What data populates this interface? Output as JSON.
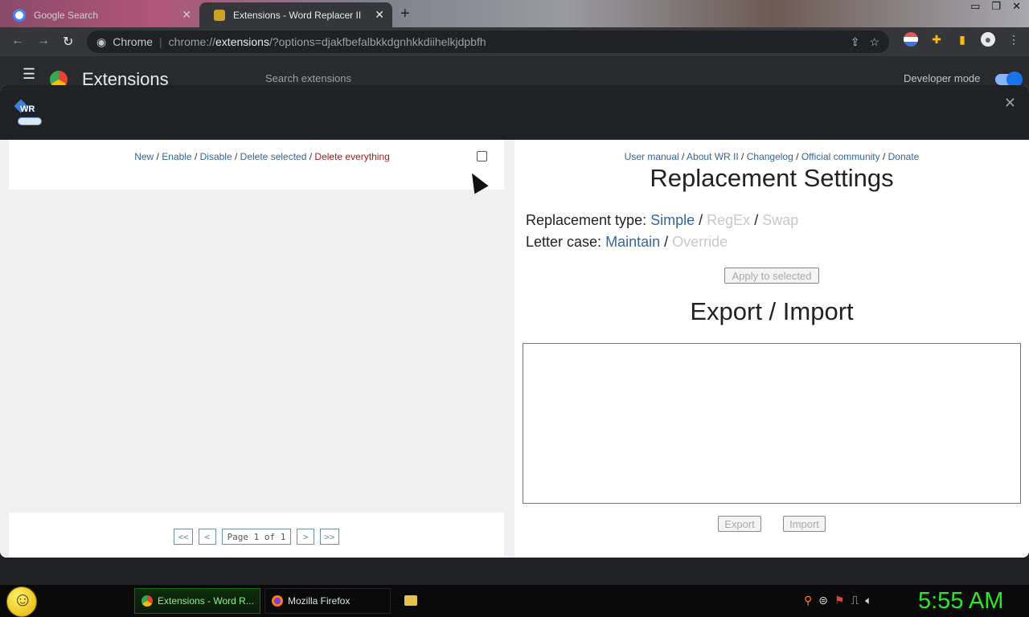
{
  "browser": {
    "tabs": [
      {
        "title": "Google Search"
      },
      {
        "title": "Extensions - Word Replacer II"
      }
    ],
    "url_prefix": "Chrome",
    "url_scheme": "chrome://",
    "url_host": "extensions",
    "url_rest": "/?options=djakfbefalbkkdgnhkkdiihelkjdpbfh"
  },
  "extensions_page": {
    "title": "Extensions",
    "search_placeholder": "Search extensions",
    "dev_mode_label": "Developer mode"
  },
  "dialog": {
    "logo_text": "WR",
    "left": {
      "links": {
        "new": "New",
        "enable": "Enable",
        "disable": "Disable",
        "delete_selected": "Delete selected",
        "delete_everything": "Delete everything"
      },
      "pager": {
        "first": "<<",
        "prev": "<",
        "page": "Page 1 of 1",
        "next": ">",
        "last": ">>"
      }
    },
    "right": {
      "links": {
        "manual": "User manual",
        "about": "About WR II",
        "changelog": "Changelog",
        "community": "Official community",
        "donate": "Donate"
      },
      "settings_title": "Replacement Settings",
      "type_label": "Replacement type:",
      "type_options": [
        "Simple",
        "RegEx",
        "Swap"
      ],
      "case_label": "Letter case:",
      "case_options": [
        "Maintain",
        "Override"
      ],
      "apply_button": "Apply to selected",
      "export_title": "Export / Import",
      "export_button": "Export",
      "import_button": "Import"
    }
  },
  "taskbar": {
    "tasks": [
      {
        "label": "Extensions - Word R..."
      },
      {
        "label": "Mozilla Firefox"
      }
    ],
    "clock": "5:55 AM"
  },
  "colors": {
    "link": "#336699",
    "danger": "#a61b1b",
    "disabled": "#c8c8c8",
    "clock": "#2ee52e"
  }
}
